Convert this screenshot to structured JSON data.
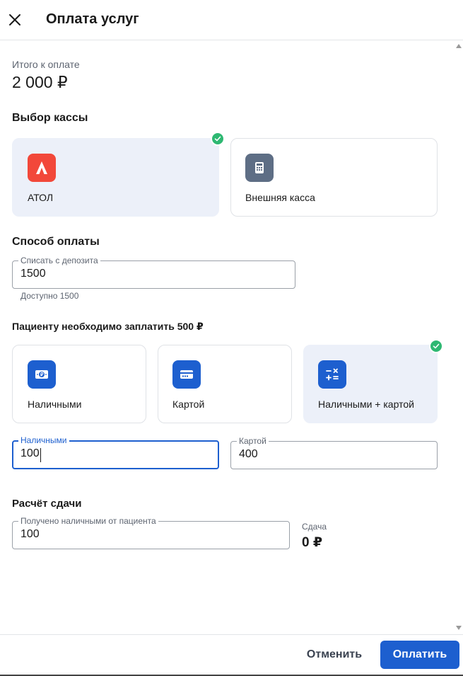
{
  "header": {
    "title": "Оплата услуг"
  },
  "total": {
    "label": "Итого к оплате",
    "value": "2 000 ₽"
  },
  "cashbox": {
    "title": "Выбор кассы",
    "options": [
      {
        "label": "АТОЛ",
        "icon": "atol-logo-icon",
        "selected": true
      },
      {
        "label": "Внешняя касса",
        "icon": "cash-register-icon",
        "selected": false
      }
    ]
  },
  "payment_method": {
    "title": "Способ оплаты",
    "deposit_field": {
      "label": "Списать с депозита",
      "value": "1500"
    },
    "available_hint": "Доступно 1500"
  },
  "patient_payment": {
    "title": "Пациенту необходимо заплатить 500 ₽",
    "options": [
      {
        "label": "Наличными",
        "icon": "cash-ruble-icon",
        "selected": false
      },
      {
        "label": "Картой",
        "icon": "card-icon",
        "selected": false
      },
      {
        "label": "Наличными + картой",
        "icon": "calculator-icon",
        "selected": true
      }
    ],
    "cash_field": {
      "label": "Наличными",
      "value": "100"
    },
    "card_field": {
      "label": "Картой",
      "value": "400"
    }
  },
  "change": {
    "title": "Расчёт сдачи",
    "received_field": {
      "label": "Получено наличными от пациента",
      "value": "100"
    },
    "change_label": "Сдача",
    "change_value": "0 ₽"
  },
  "footer": {
    "cancel_label": "Отменить",
    "pay_label": "Оплатить"
  },
  "colors": {
    "accent": "#1d5fcf",
    "check": "#2eb872",
    "atol": "#f2483a",
    "selected_bg": "#ecf0f9",
    "external_icon": "#5e6e85"
  }
}
